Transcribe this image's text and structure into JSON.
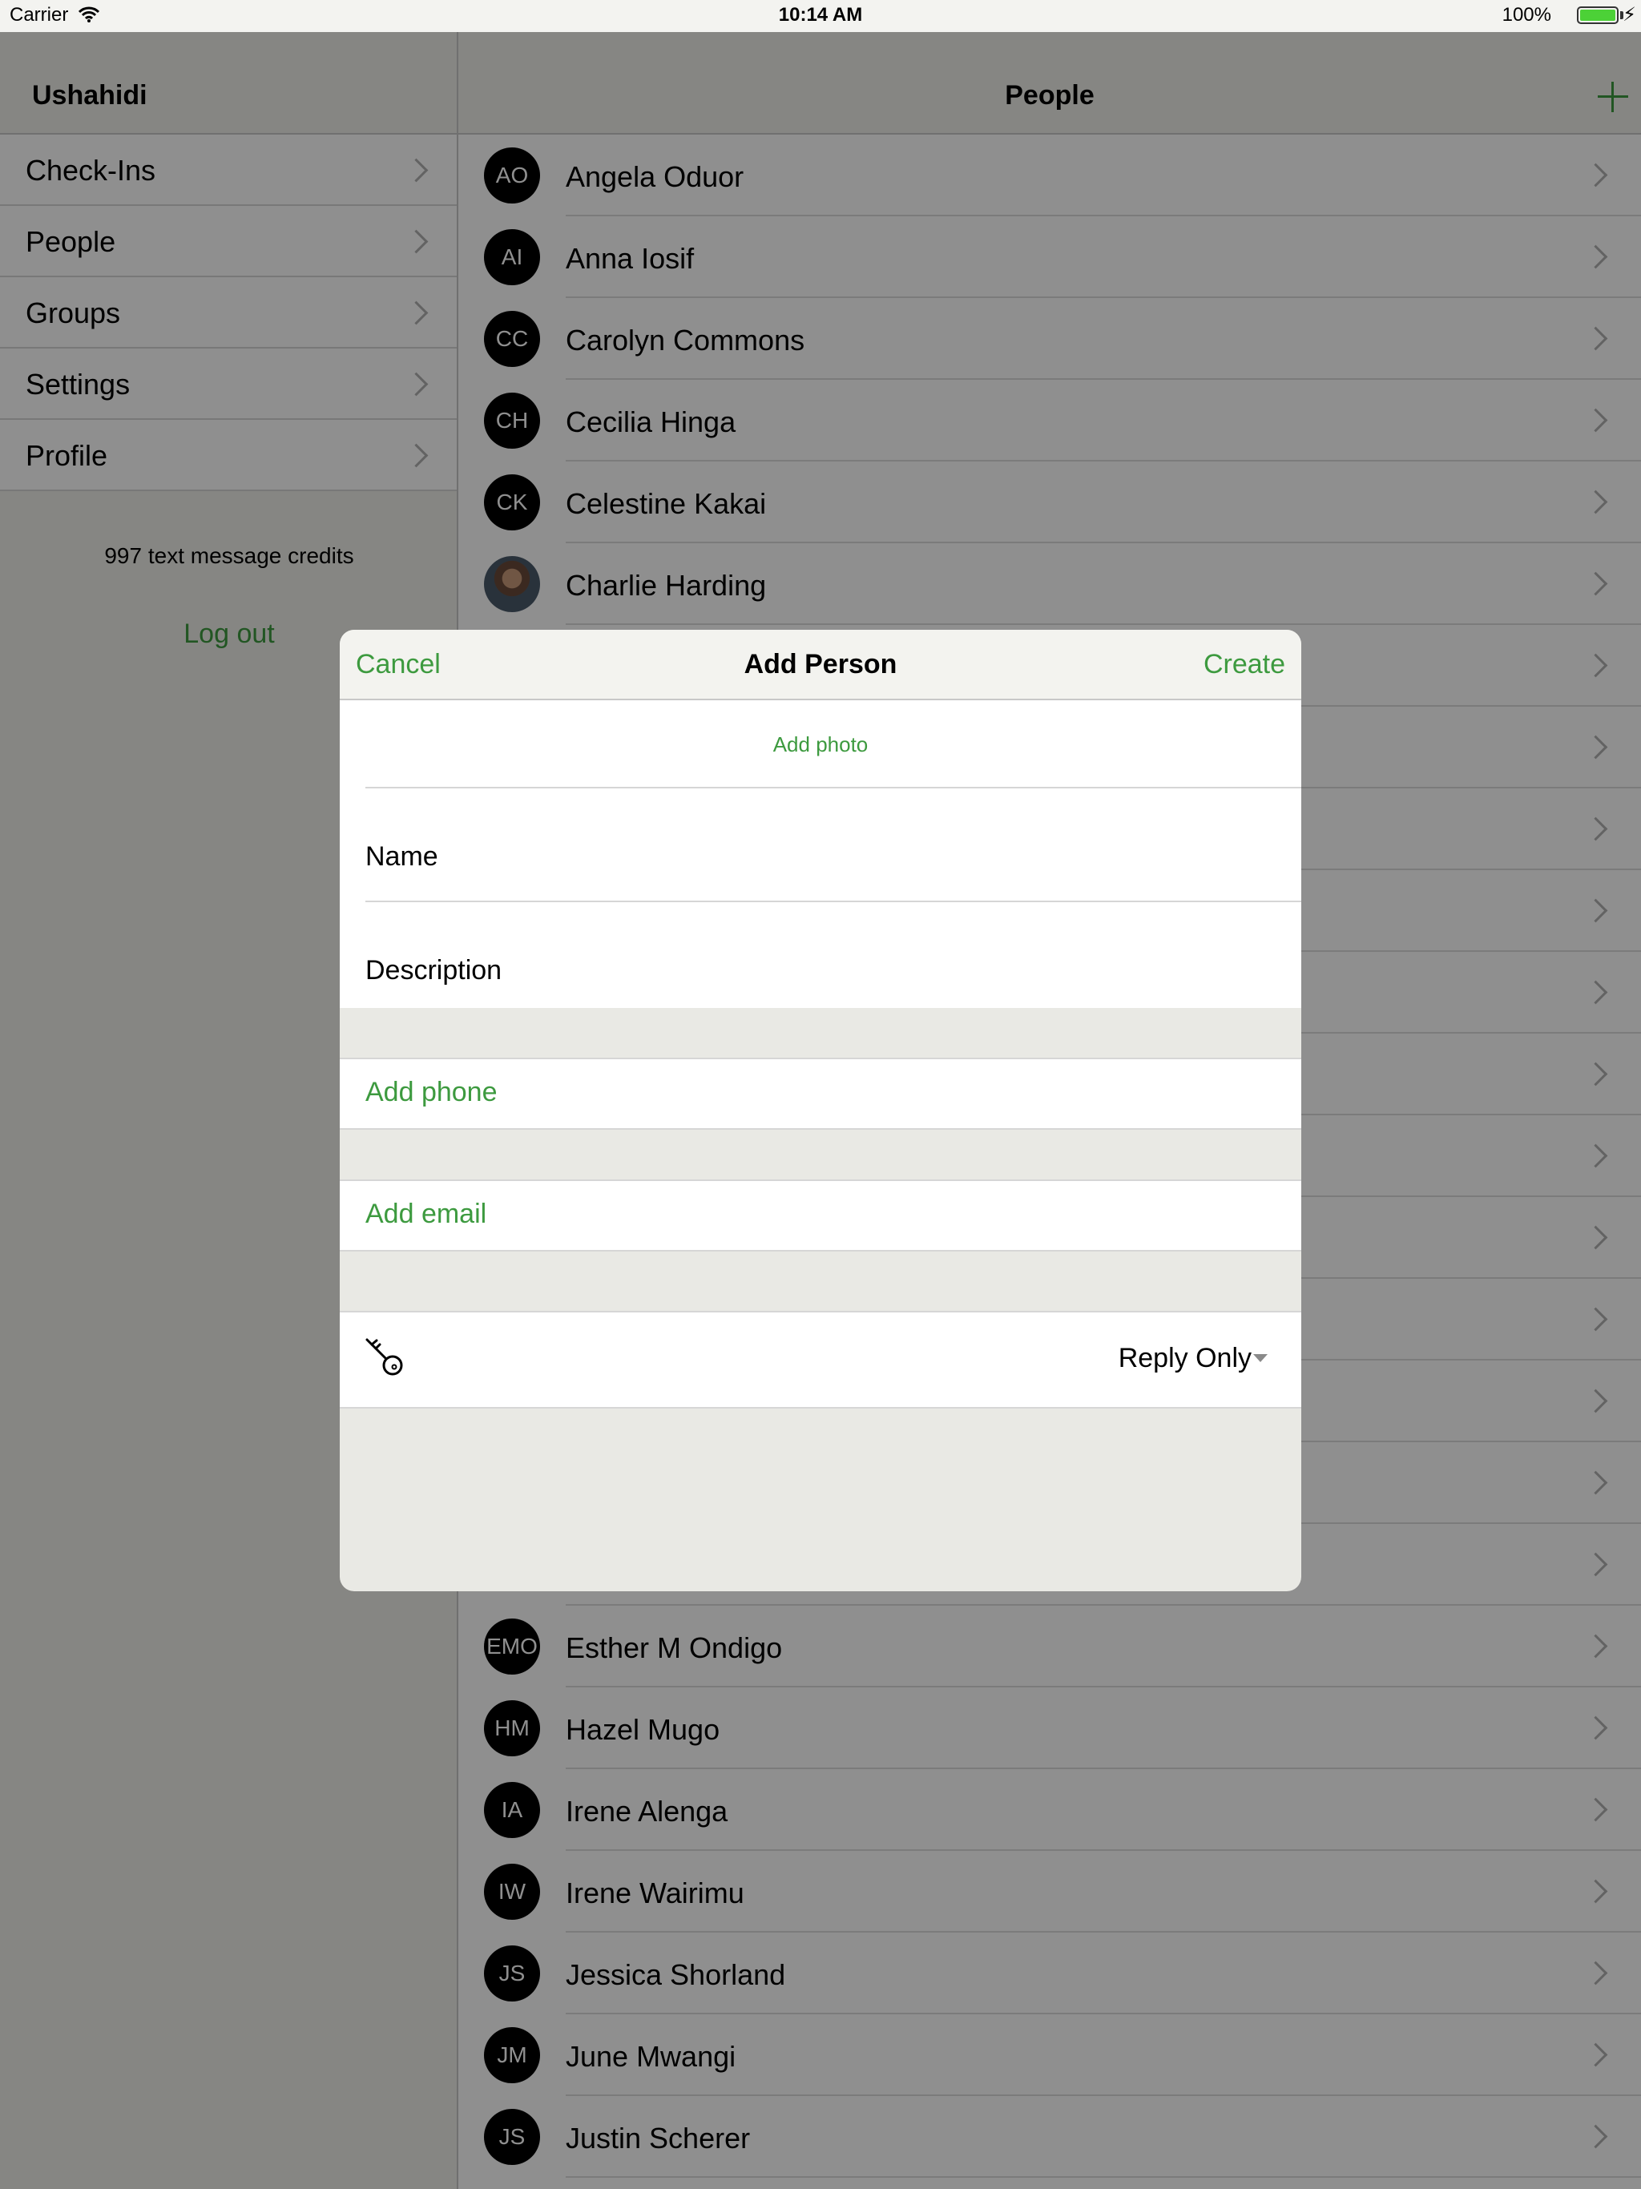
{
  "status_bar": {
    "carrier": "Carrier",
    "time": "10:14 AM",
    "battery": "100%",
    "battery_level": 1.0
  },
  "master": {
    "title": "Ushahidi",
    "menu": [
      {
        "label": "Check-Ins"
      },
      {
        "label": "People"
      },
      {
        "label": "Groups"
      },
      {
        "label": "Settings"
      },
      {
        "label": "Profile"
      }
    ],
    "credits": "997 text message credits",
    "logout_label": "Log out"
  },
  "detail": {
    "title": "People",
    "add_icon": "plus-icon",
    "people": [
      {
        "initials": "AO",
        "name": "Angela Oduor",
        "photo": false
      },
      {
        "initials": "AI",
        "name": "Anna Iosif",
        "photo": false
      },
      {
        "initials": "CC",
        "name": "Carolyn Commons",
        "photo": false
      },
      {
        "initials": "CH",
        "name": "Cecilia Hinga",
        "photo": false
      },
      {
        "initials": "CK",
        "name": "Celestine Kakai",
        "photo": false
      },
      {
        "initials": "",
        "name": "Charlie Harding",
        "photo": true
      },
      {
        "initials": "EMO",
        "name": "Esther M Ondigo",
        "photo": false
      },
      {
        "initials": "HM",
        "name": "Hazel Mugo",
        "photo": false
      },
      {
        "initials": "IA",
        "name": "Irene Alenga",
        "photo": false
      },
      {
        "initials": "IW",
        "name": "Irene Wairimu",
        "photo": false
      },
      {
        "initials": "JS",
        "name": "Jessica Shorland",
        "photo": false
      },
      {
        "initials": "JM",
        "name": "June Mwangi",
        "photo": false
      },
      {
        "initials": "JS",
        "name": "Justin Scherer",
        "photo": false
      }
    ]
  },
  "modal": {
    "cancel_label": "Cancel",
    "title": "Add Person",
    "create_label": "Create",
    "add_photo_label": "Add photo",
    "name_label": "Name",
    "name_value": "",
    "description_label": "Description",
    "description_value": "",
    "add_phone_label": "Add phone",
    "add_email_label": "Add email",
    "role_icon": "key-icon",
    "role_value": "Reply Only"
  },
  "colors": {
    "accent": "#3d9a3f",
    "background_gray": "#efefea",
    "avatar": "#000000"
  }
}
